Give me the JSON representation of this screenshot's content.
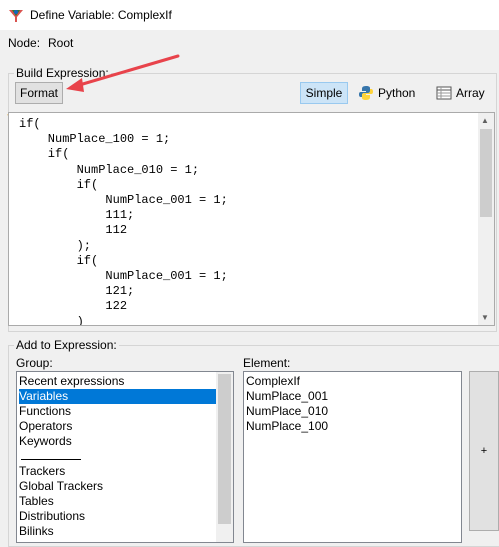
{
  "window": {
    "title": "Define Variable: ComplexIf"
  },
  "node": {
    "label": "Node:",
    "value": "Root"
  },
  "build": {
    "legend": "Build Expression:",
    "format_label": "Format",
    "simple_label": "Simple",
    "python_label": "Python",
    "array_label": "Array",
    "code": "if(\n    NumPlace_100 = 1;\n    if(\n        NumPlace_010 = 1;\n        if(\n            NumPlace_001 = 1;\n            111;\n            112\n        );\n        if(\n            NumPlace_001 = 1;\n            121;\n            122\n        )"
  },
  "add": {
    "legend": "Add to Expression:",
    "group_label": "Group:",
    "element_label": "Element:",
    "groups": [
      "Recent expressions",
      "Variables",
      "Functions",
      "Operators",
      "Keywords",
      "Trackers",
      "Global Trackers",
      "Tables",
      "Distributions",
      "Bilinks"
    ],
    "selected_group": "Variables",
    "elements": [
      "ComplexIf",
      "NumPlace_001",
      "NumPlace_010",
      "NumPlace_100"
    ],
    "add_button_label": "+"
  },
  "colors": {
    "selection": "#0078d7",
    "active_toggle": "#cce4f7",
    "annotation_arrow": "#e8434b"
  }
}
